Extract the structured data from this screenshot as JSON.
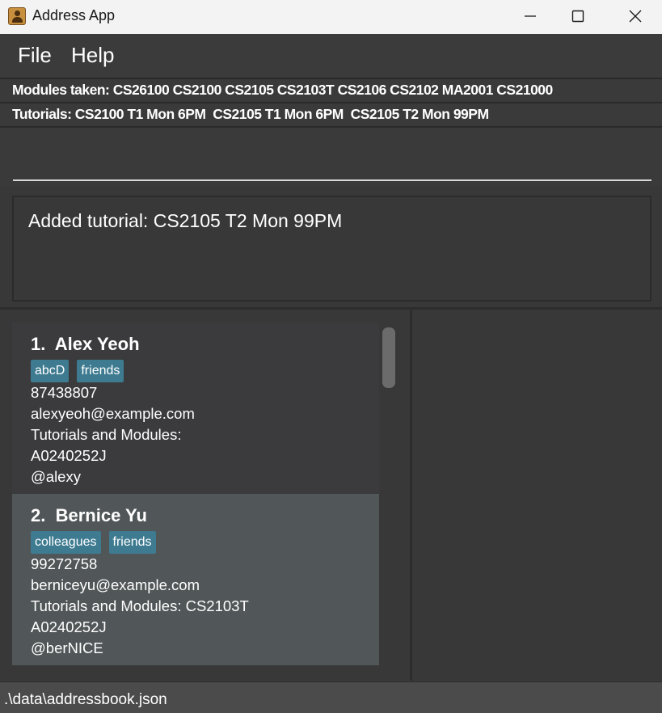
{
  "window": {
    "title": "Address App",
    "icon": "address-book-icon"
  },
  "menu": {
    "items": [
      "File",
      "Help"
    ]
  },
  "info": {
    "modules_taken": "Modules taken: CS26100 CS2100 CS2105 CS2103T CS2106 CS2102 MA2001 CS21000",
    "tutorials": "Tutorials: CS2100 T1 Mon 6PM  CS2105 T1 Mon 6PM  CS2105 T2 Mon 99PM"
  },
  "command_box": {
    "value": ""
  },
  "result_display": {
    "text": "Added tutorial: CS2105 T2 Mon 99PM"
  },
  "persons": [
    {
      "index": "1.",
      "name": "Alex Yeoh",
      "tags": [
        "abcD",
        "friends"
      ],
      "phone": "87438807",
      "email": "alexyeoh@example.com",
      "tutorials_modules": "Tutorials and Modules:",
      "student_id": "A0240252J",
      "handle": "@alexy"
    },
    {
      "index": "2.",
      "name": "Bernice Yu",
      "tags": [
        "colleagues",
        "friends"
      ],
      "phone": "99272758",
      "email": "berniceyu@example.com",
      "tutorials_modules": "Tutorials and Modules: CS2103T",
      "student_id": "A0240252J",
      "handle": "@berNICE"
    }
  ],
  "status_bar": {
    "path": ".\\data\\addressbook.json"
  },
  "colors": {
    "background": "#383838",
    "card_odd": "#3b3b3d",
    "card_even": "#515658",
    "tag": "#3e7b91"
  }
}
